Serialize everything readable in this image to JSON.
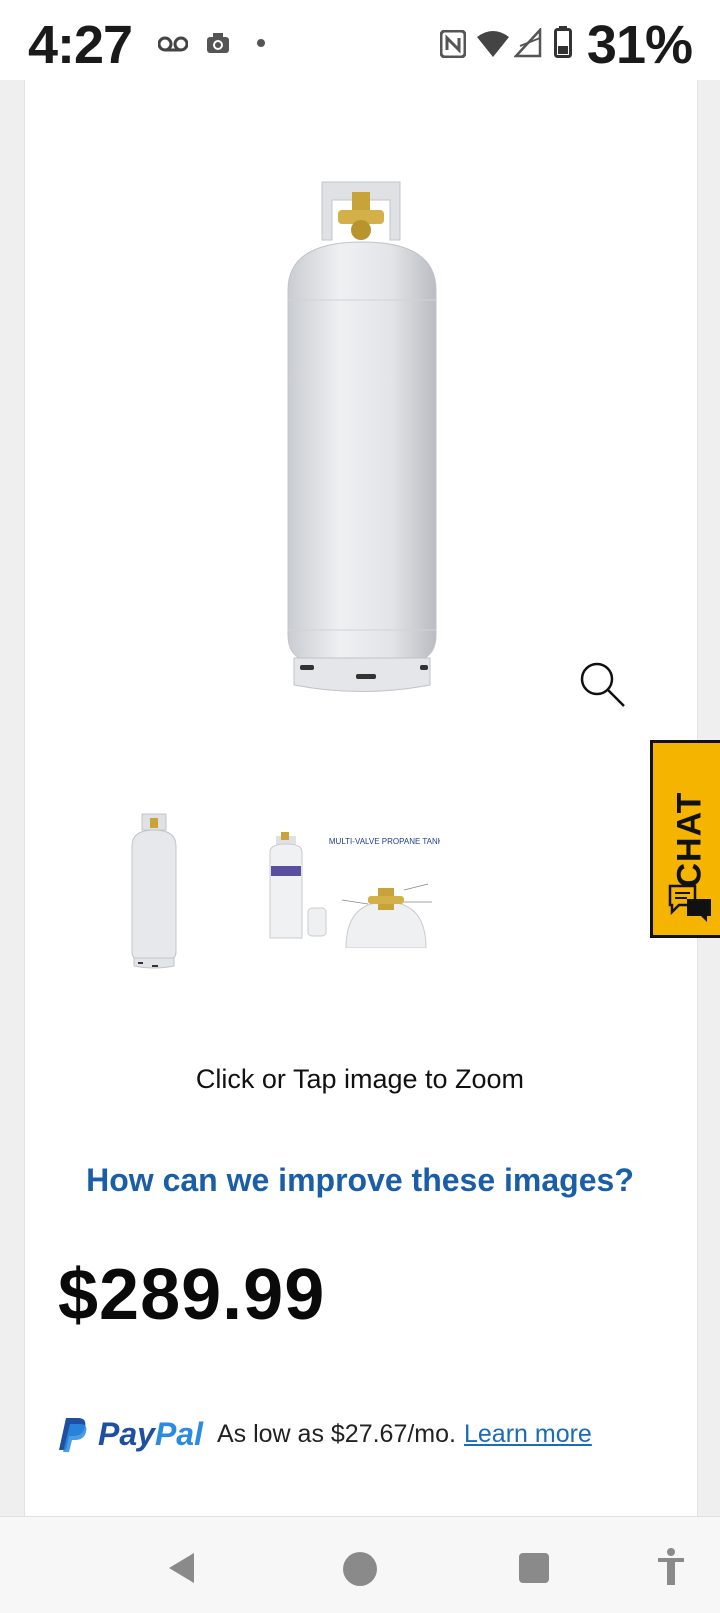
{
  "status_bar": {
    "time": "4:27",
    "battery_percent": "31%",
    "icons": [
      "voicemail-icon",
      "camera-icon",
      "dot-icon",
      "nfc-icon",
      "wifi-icon",
      "signal-icon",
      "battery-icon"
    ]
  },
  "product": {
    "main_image": "white-propane-tank",
    "thumbnails": [
      "propane-tank-thumbnail",
      "multi-valve-propane-tank-diagram"
    ],
    "thumbnail_2_caption": "MULTI-VALVE PROPANE TANK",
    "zoom_hint": "Click or Tap image to Zoom",
    "improve_images_link": "How can we improve these images?",
    "price": "$289.99"
  },
  "chat": {
    "label": "CHAT",
    "color": "#f5b400"
  },
  "paypal": {
    "brand_pay": "Pay",
    "brand_pal": "Pal",
    "text": "As low as $27.67/mo.",
    "learn_more": "Learn more"
  },
  "nav_bar": {
    "buttons": [
      "back-icon",
      "home-icon",
      "recents-icon",
      "accessibility-icon"
    ]
  },
  "colors": {
    "link_blue": "#1a5ea8",
    "paypal_dark": "#1f4fa0",
    "paypal_light": "#2a8be0"
  }
}
